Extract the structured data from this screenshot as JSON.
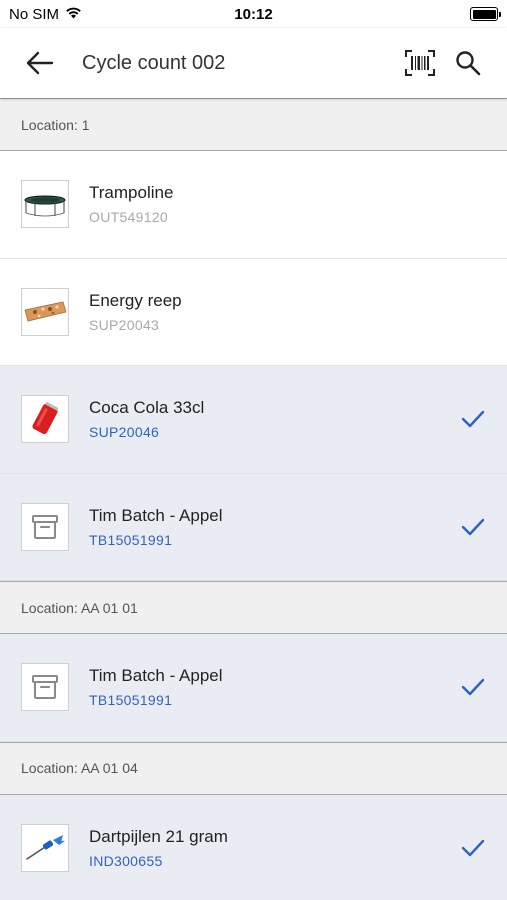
{
  "status_bar": {
    "carrier": "No SIM",
    "time": "10:12"
  },
  "app_bar": {
    "title": "Cycle count 002",
    "back_icon": "arrow-left-icon",
    "actions": [
      "barcode-scan-icon",
      "search-icon"
    ]
  },
  "colors": {
    "accent": "#2f63c1",
    "counted_background": "#e9edf3",
    "section_background": "#f0f0f0"
  },
  "sections": [
    {
      "label": "Location: 1",
      "items": [
        {
          "name": "Trampoline",
          "code": "OUT549120",
          "image": "trampoline-image",
          "counted": false
        },
        {
          "name": "Energy reep",
          "code": "SUP20043",
          "image": "energy-bar-image",
          "counted": false
        },
        {
          "name": "Coca Cola 33cl",
          "code": "SUP20046",
          "image": "cola-can-image",
          "counted": true
        },
        {
          "name": "Tim Batch - Appel",
          "code": "TB15051991",
          "image": "archive-box-icon",
          "counted": true
        }
      ]
    },
    {
      "label": "Location: AA 01 01",
      "items": [
        {
          "name": "Tim Batch - Appel",
          "code": "TB15051991",
          "image": "archive-box-icon",
          "counted": true
        }
      ]
    },
    {
      "label": "Location: AA 01 04",
      "items": [
        {
          "name": "Dartpijlen 21 gram",
          "code": "IND300655",
          "image": "dart-image",
          "counted": true
        }
      ]
    }
  ]
}
